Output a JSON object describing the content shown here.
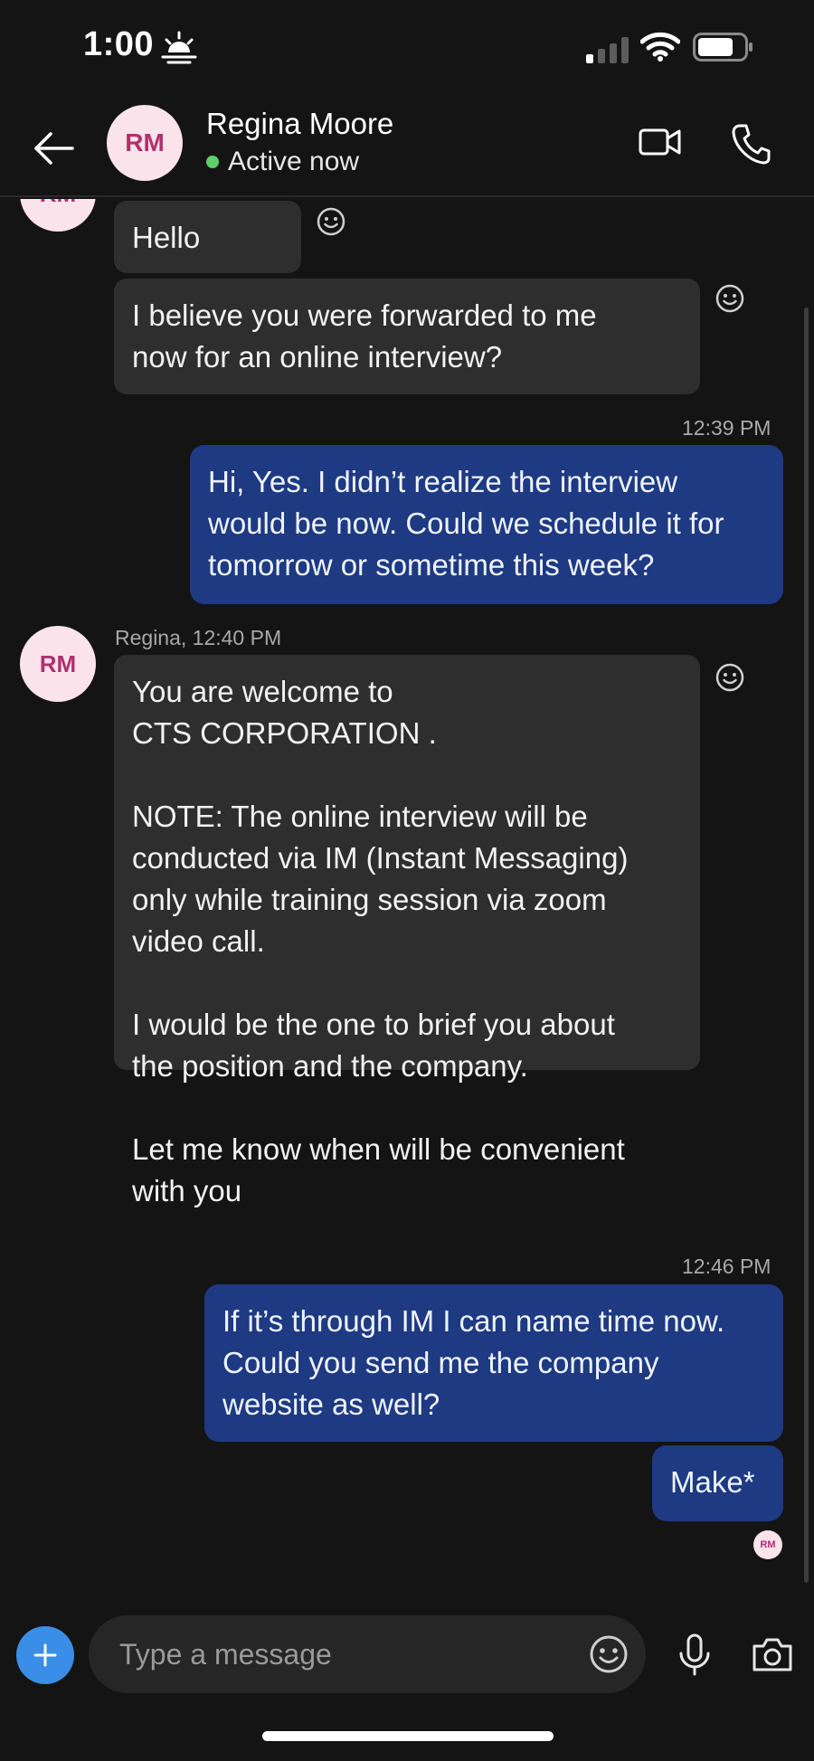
{
  "status_bar": {
    "time": "1:00"
  },
  "header": {
    "avatar_initials": "RM",
    "contact_name": "Regina Moore",
    "presence": "Active now"
  },
  "messages": [
    {
      "direction": "incoming",
      "text": "Hello"
    },
    {
      "direction": "incoming",
      "text": "I believe you were forwarded to me\nnow for an online interview?"
    },
    {
      "direction": "outgoing",
      "timestamp": "12:39 PM",
      "text": "Hi, Yes. I didn’t realize the interview\nwould be now. Could we schedule it for\ntomorrow or sometime this week?"
    },
    {
      "direction": "incoming",
      "sender_meta": "Regina, 12:40 PM",
      "text": "You are welcome to\nCTS CORPORATION .\n\nNOTE: The online interview will be\nconducted via IM (Instant Messaging)\nonly while training session via zoom\nvideo call.\n\nI would be the one to brief you about\nthe position and the company.\n\nLet me know when will be convenient\nwith you"
    },
    {
      "direction": "outgoing",
      "timestamp": "12:46 PM",
      "text": "If it’s through IM I can name time now.\nCould you send me the company\nwebsite as well?"
    },
    {
      "direction": "outgoing",
      "text": "Make*"
    }
  ],
  "chat": {
    "avatar_initials": "RM",
    "read_receipt_initials": "RM"
  },
  "composer": {
    "placeholder": "Type a message"
  },
  "icons": {
    "status_sun": "sunrise-icon",
    "back": "back-arrow-icon",
    "video": "video-camera-icon",
    "call": "phone-icon",
    "react": "smiley-icon",
    "add": "plus-icon",
    "emoji": "emoji-icon",
    "mic": "microphone-icon",
    "camera": "camera-icon"
  },
  "colors": {
    "background": "#141414",
    "incoming_bubble": "#2e2e2e",
    "outgoing_bubble": "#1d3a82",
    "presence": "#5fcf6a",
    "accent": "#3a8ee8",
    "avatar_bg": "#fbe3ec",
    "avatar_text": "#b0306e"
  }
}
